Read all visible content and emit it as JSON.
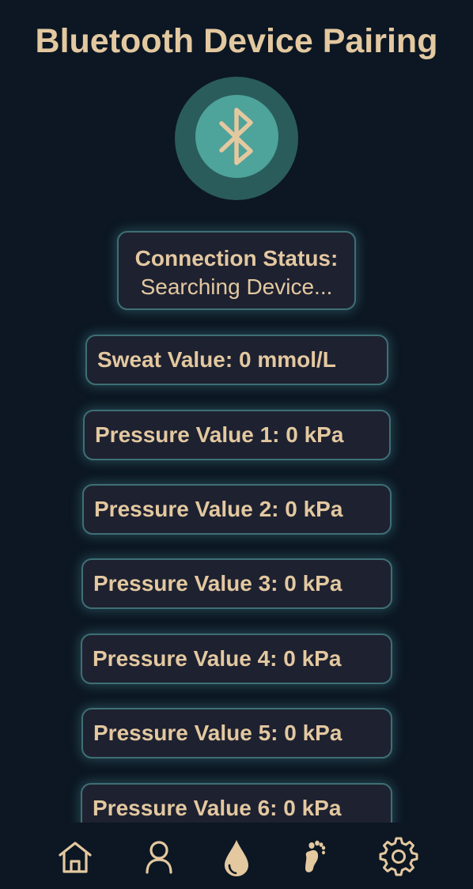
{
  "page": {
    "title": "Bluetooth Device Pairing"
  },
  "bluetooth": {
    "icon": "bluetooth-icon"
  },
  "status": {
    "label": "Connection Status:",
    "value": "Searching Device..."
  },
  "sweat": {
    "label": "Sweat Value: 0 mmol/L"
  },
  "pressures": [
    "Pressure Value 1: 0 kPa",
    "Pressure Value 2: 0 kPa",
    "Pressure Value 3: 0 kPa",
    "Pressure Value 4: 0 kPa",
    "Pressure Value 5: 0 kPa",
    "Pressure Value 6: 0 kPa"
  ],
  "nav": {
    "items": [
      {
        "icon": "home-icon"
      },
      {
        "icon": "user-icon"
      },
      {
        "icon": "drop-icon"
      },
      {
        "icon": "footprint-icon"
      },
      {
        "icon": "gear-icon"
      }
    ]
  },
  "colors": {
    "background": "#0c1723",
    "accent_text": "#e3c8a0",
    "card_background": "#1e2130",
    "card_border": "#3e6f74",
    "bluetooth_outer": "#2a5c5b",
    "bluetooth_inner": "#4ea39a"
  }
}
